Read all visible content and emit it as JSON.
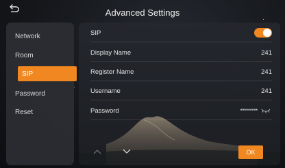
{
  "header": {
    "title": "Advanced Settings",
    "back_icon": "back-arrow-icon"
  },
  "sidebar": {
    "items": [
      {
        "label": "Network",
        "active": false
      },
      {
        "label": "Room",
        "active": false
      },
      {
        "label": "SIP",
        "active": true
      },
      {
        "label": "Password",
        "active": false
      },
      {
        "label": "Reset",
        "active": false
      }
    ]
  },
  "form": {
    "sip": {
      "label": "SIP",
      "enabled": true
    },
    "display_name": {
      "label": "Display Name",
      "value": "241"
    },
    "register_name": {
      "label": "Register Name",
      "value": "241"
    },
    "username": {
      "label": "Username",
      "value": "241"
    },
    "password": {
      "label": "Password",
      "value": "*********",
      "visibility_icon": "eye-hidden-icon"
    }
  },
  "footer": {
    "prev_icon": "chevron-up-icon",
    "next_icon": "chevron-down-icon",
    "ok_label": "OK"
  },
  "colors": {
    "accent": "#F18721",
    "panel": "#24272D",
    "background": "#15171B"
  }
}
